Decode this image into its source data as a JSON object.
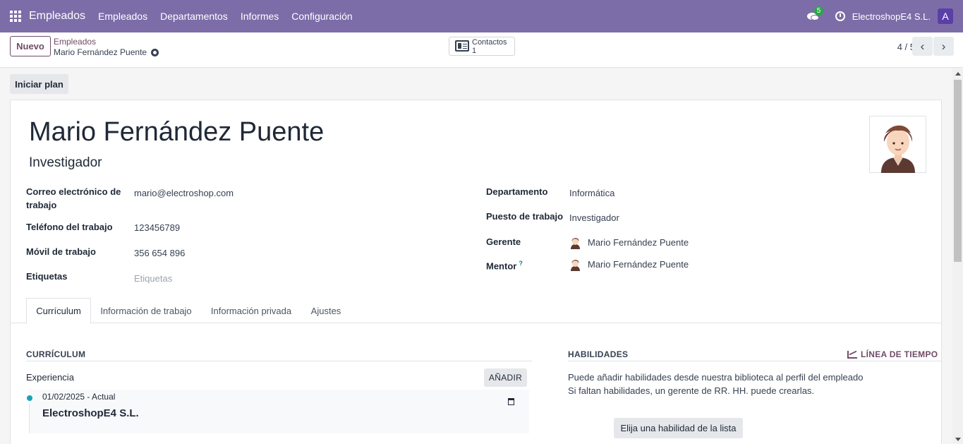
{
  "navbar": {
    "app_name": "Empleados",
    "menus": [
      "Empleados",
      "Departamentos",
      "Informes",
      "Configuración"
    ],
    "chat_badge": "5",
    "company": "ElectroshopE4 S.L.",
    "user_initial": "A",
    "color": "#7c6da8"
  },
  "control": {
    "new_label": "Nuevo",
    "breadcrumb_parent": "Empleados",
    "breadcrumb_current": "Mario Fernández Puente",
    "contacts_label": "Contactos",
    "contacts_count": "1",
    "pager": "4 / 5",
    "prev_icon": "‹",
    "next_icon": "›"
  },
  "actions": {
    "start_plan": "Iniciar plan"
  },
  "employee": {
    "name": "Mario Fernández Puente",
    "job_title": "Investigador"
  },
  "fields_left": [
    {
      "label": "Correo electrónico de trabajo",
      "value": "mario@electroshop.com"
    },
    {
      "label": "Teléfono del trabajo",
      "value": "123456789"
    },
    {
      "label": "Móvil de trabajo",
      "value": "356 654 896"
    },
    {
      "label": "Etiquetas",
      "placeholder": "Etiquetas"
    }
  ],
  "fields_right": [
    {
      "label": "Departamento",
      "value": "Informática"
    },
    {
      "label": "Puesto de trabajo",
      "value": "Investigador"
    },
    {
      "label": "Gerente",
      "value": "Mario Fernández Puente"
    },
    {
      "label": "Mentor",
      "value": "Mario Fernández Puente",
      "help": "?"
    }
  ],
  "tabs": [
    "Currículum",
    "Información de trabajo",
    "Información privada",
    "Ajustes"
  ],
  "resume": {
    "title": "CURRÍCULUM",
    "group": "Experiencia",
    "add_label": "AÑADIR",
    "entry_date": "01/02/2025 - Actual",
    "entry_name": "ElectroshopE4 S.L."
  },
  "skills": {
    "title": "HABILIDADES",
    "timeline_label": "LÍNEA DE TIEMPO",
    "help_line1": "Puede añadir habilidades desde nuestra biblioteca al perfil del empleado",
    "help_line2": "Si faltan habilidades, un gerente de RR. HH. puede crearlas.",
    "choose_label": "Elija una habilidad de la lista"
  }
}
